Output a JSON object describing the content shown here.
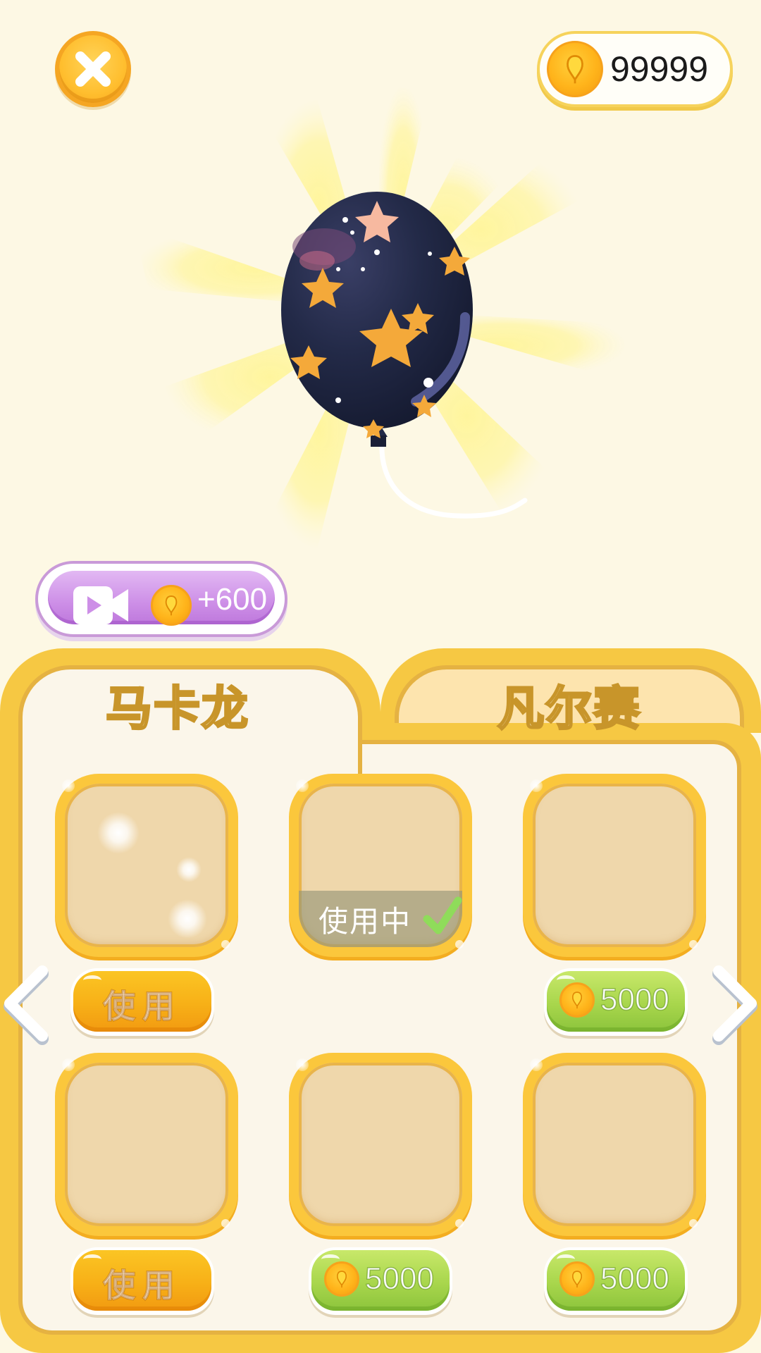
{
  "header": {
    "coin_amount": "99999"
  },
  "video_reward": {
    "amount_text": "+600"
  },
  "tabs": [
    {
      "label": "马卡龙",
      "active": true
    },
    {
      "label": "凡尔赛",
      "active": false
    }
  ],
  "slots": [
    {
      "status": "sparkle",
      "button": {
        "type": "use",
        "label": "使用"
      }
    },
    {
      "status": "in_use",
      "overlay_text": "使用中",
      "button": null
    },
    {
      "status": "locked",
      "button": {
        "type": "buy",
        "price": "5000"
      }
    },
    {
      "status": "owned",
      "button": {
        "type": "use",
        "label": "使用"
      }
    },
    {
      "status": "locked",
      "button": {
        "type": "buy",
        "price": "5000"
      }
    },
    {
      "status": "locked",
      "button": {
        "type": "buy",
        "price": "5000"
      }
    }
  ],
  "icons": [
    "close-icon",
    "coin-icon",
    "balloon-icon",
    "video-icon",
    "checkmark-icon",
    "chevron-left-icon",
    "chevron-right-icon"
  ],
  "colors": {
    "background": "#fdf8e4",
    "panel_frame": "#f6c843",
    "use_button": "#f7b017",
    "buy_button": "#a8d64c",
    "video_button": "#cd8fe7",
    "balloon": "#232a48",
    "star": "#f4a93a"
  }
}
